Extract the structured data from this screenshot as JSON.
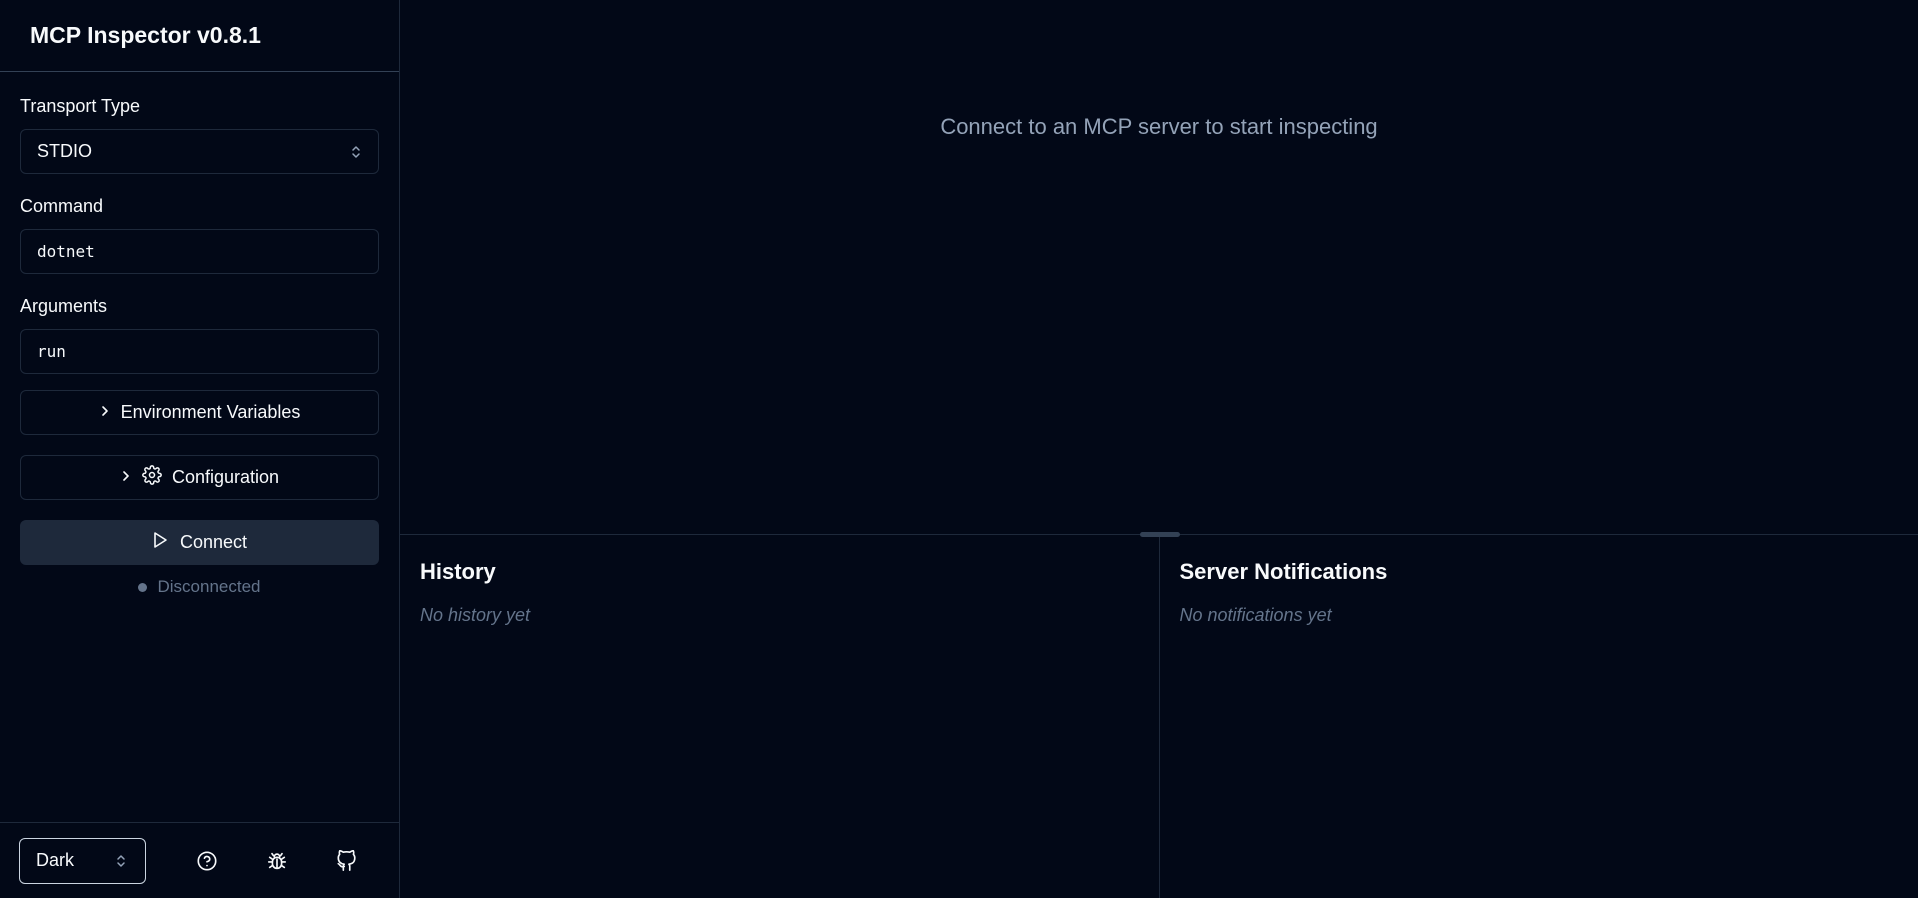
{
  "app": {
    "title": "MCP Inspector v0.8.1"
  },
  "sidebar": {
    "transport": {
      "label": "Transport Type",
      "value": "STDIO"
    },
    "command": {
      "label": "Command",
      "value": "dotnet"
    },
    "arguments": {
      "label": "Arguments",
      "value": "run"
    },
    "env_button": "Environment Variables",
    "config_button": "Configuration",
    "connect_button": "Connect",
    "status": "Disconnected"
  },
  "footer": {
    "theme": "Dark",
    "icons": [
      "help-circle-icon",
      "bug-icon",
      "github-icon"
    ]
  },
  "main": {
    "placeholder": "Connect to an MCP server to start inspecting",
    "history": {
      "title": "History",
      "empty": "No history yet"
    },
    "notifications": {
      "title": "Server Notifications",
      "empty": "No notifications yet"
    }
  },
  "colors": {
    "background": "#020817",
    "border": "#1e293b",
    "button": "#1e293b",
    "muted_text": "#64748b",
    "text": "#f8fafc"
  }
}
